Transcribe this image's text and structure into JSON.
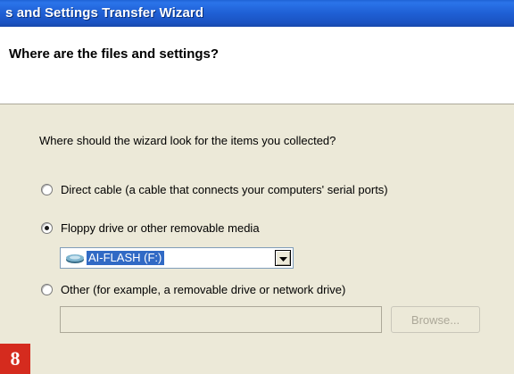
{
  "window": {
    "title": "s and Settings Transfer Wizard"
  },
  "header": {
    "title": "Where are the files and settings?"
  },
  "question": "Where should the wizard look for the items you collected?",
  "options": [
    {
      "label": "Direct cable (a cable that connects your computers' serial ports)",
      "selected": false
    },
    {
      "label": "Floppy drive or other removable media",
      "selected": true
    },
    {
      "label": "Other (for example, a removable drive or network drive)",
      "selected": false
    }
  ],
  "drive_select": {
    "value": "AI-FLASH (F:)",
    "icon": "removable-drive-icon"
  },
  "path_input": {
    "value": ""
  },
  "browse_button": {
    "label": "Browse...",
    "enabled": false
  },
  "step_badge": "8",
  "colors": {
    "titlebar": "#1f5fd4",
    "dialog_face": "#ece9d8",
    "selection": "#316ac5",
    "badge": "#d52b1e"
  }
}
